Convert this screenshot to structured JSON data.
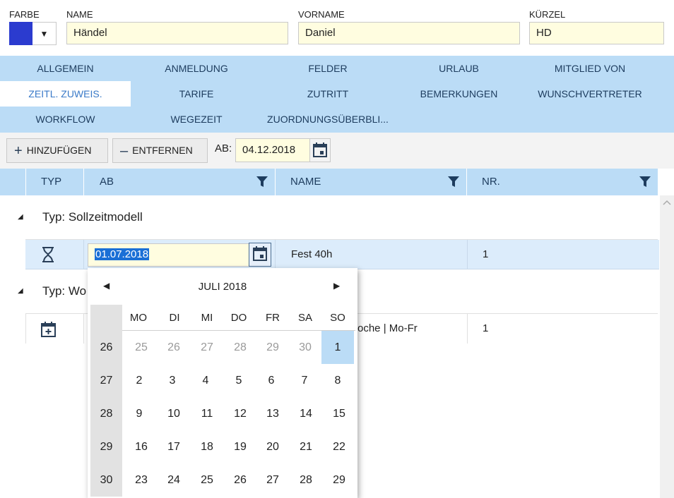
{
  "header": {
    "farbe_label": "FARBE",
    "name_label": "NAME",
    "name_value": "Händel",
    "vorname_label": "VORNAME",
    "vorname_value": "Daniel",
    "kuerzel_label": "KÜRZEL",
    "kuerzel_value": "HD",
    "color_value": "#2b3bcf"
  },
  "tabs": [
    "ALLGEMEIN",
    "ANMELDUNG",
    "FELDER",
    "URLAUB",
    "MITGLIED VON",
    "ZEITL. ZUWEIS.",
    "TARIFE",
    "ZUTRITT",
    "BEMERKUNGEN",
    "WUNSCHVERTRETER",
    "WORKFLOW",
    "WEGEZEIT",
    "ZUORDNUNGSÜBERBLI..."
  ],
  "active_tab": "ZEITL. ZUWEIS.",
  "toolbar": {
    "add_label": "HINZUFÜGEN",
    "remove_label": "ENTFERNEN",
    "ab_label": "AB:",
    "ab_value": "04.12.2018"
  },
  "grid": {
    "columns": [
      "TYP",
      "AB",
      "NAME",
      "NR."
    ],
    "groups": [
      {
        "title": "Typ: Sollzeitmodell",
        "row": {
          "icon": "hourglass-icon",
          "ab": "01.07.2018",
          "name": "Fest 40h",
          "nr": "1"
        }
      },
      {
        "title": "Typ: Wo",
        "row": {
          "icon": "calendar-plus-icon",
          "name": "oche | Mo-Fr",
          "nr": "1"
        }
      }
    ]
  },
  "calendar": {
    "month_label": "JULI 2018",
    "weekdays": [
      "MO",
      "DI",
      "MI",
      "DO",
      "FR",
      "SA",
      "SO"
    ],
    "weeks": [
      {
        "kw": "26",
        "days": [
          "25",
          "26",
          "27",
          "28",
          "29",
          "30",
          "1"
        ]
      },
      {
        "kw": "27",
        "days": [
          "2",
          "3",
          "4",
          "5",
          "6",
          "7",
          "8"
        ]
      },
      {
        "kw": "28",
        "days": [
          "9",
          "10",
          "11",
          "12",
          "13",
          "14",
          "15"
        ]
      },
      {
        "kw": "29",
        "days": [
          "16",
          "17",
          "18",
          "19",
          "20",
          "21",
          "22"
        ]
      },
      {
        "kw": "30",
        "days": [
          "23",
          "24",
          "25",
          "26",
          "27",
          "28",
          "29"
        ]
      }
    ],
    "selected_day": "1",
    "selection_color": "#bbdcf6"
  }
}
